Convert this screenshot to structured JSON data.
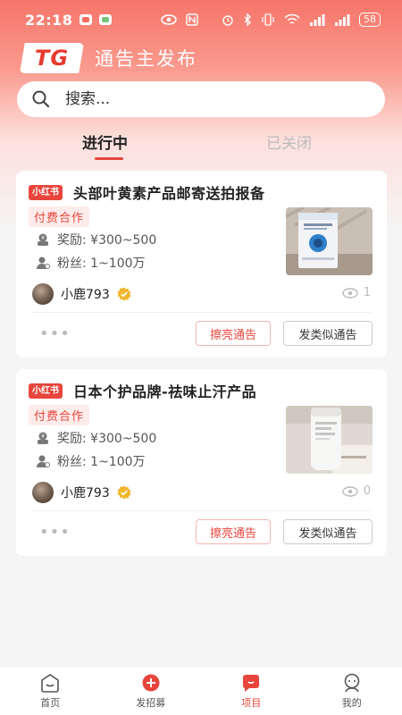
{
  "status_bar": {
    "time": "22:18",
    "battery": "58"
  },
  "header": {
    "logo": "TG",
    "title": "通告主发布"
  },
  "search": {
    "placeholder": "搜索..."
  },
  "tabs": [
    {
      "label": "进行中",
      "active": true
    },
    {
      "label": "已关闭",
      "active": false
    }
  ],
  "cards": [
    {
      "platform": "小红书",
      "title": "头部叶黄素产品邮寄送拍报备",
      "tag": "付费合作",
      "reward": "奖励: ¥300~500",
      "fans": "粉丝:  1~100万",
      "author": "小鹿793",
      "views": "1",
      "btn_highlight": "擦亮通告",
      "btn_similar": "发类似通告",
      "more": "•••"
    },
    {
      "platform": "小红书",
      "title": "日本个护品牌-祛味止汗产品",
      "tag": "付费合作",
      "reward": "奖励: ¥300~500",
      "fans": "粉丝:  1~100万",
      "author": "小鹿793",
      "views": "0",
      "btn_highlight": "擦亮通告",
      "btn_similar": "发类似通告",
      "more": "•••"
    }
  ],
  "bottom_nav": [
    {
      "label": "首页",
      "icon": "home-icon",
      "active": false
    },
    {
      "label": "发招募",
      "icon": "plus-circle-icon",
      "active": false
    },
    {
      "label": "项目",
      "icon": "project-icon",
      "active": true
    },
    {
      "label": "我的",
      "icon": "profile-icon",
      "active": false
    }
  ],
  "colors": {
    "accent": "#e8453c",
    "header_gradient_top": "#f6756a"
  }
}
